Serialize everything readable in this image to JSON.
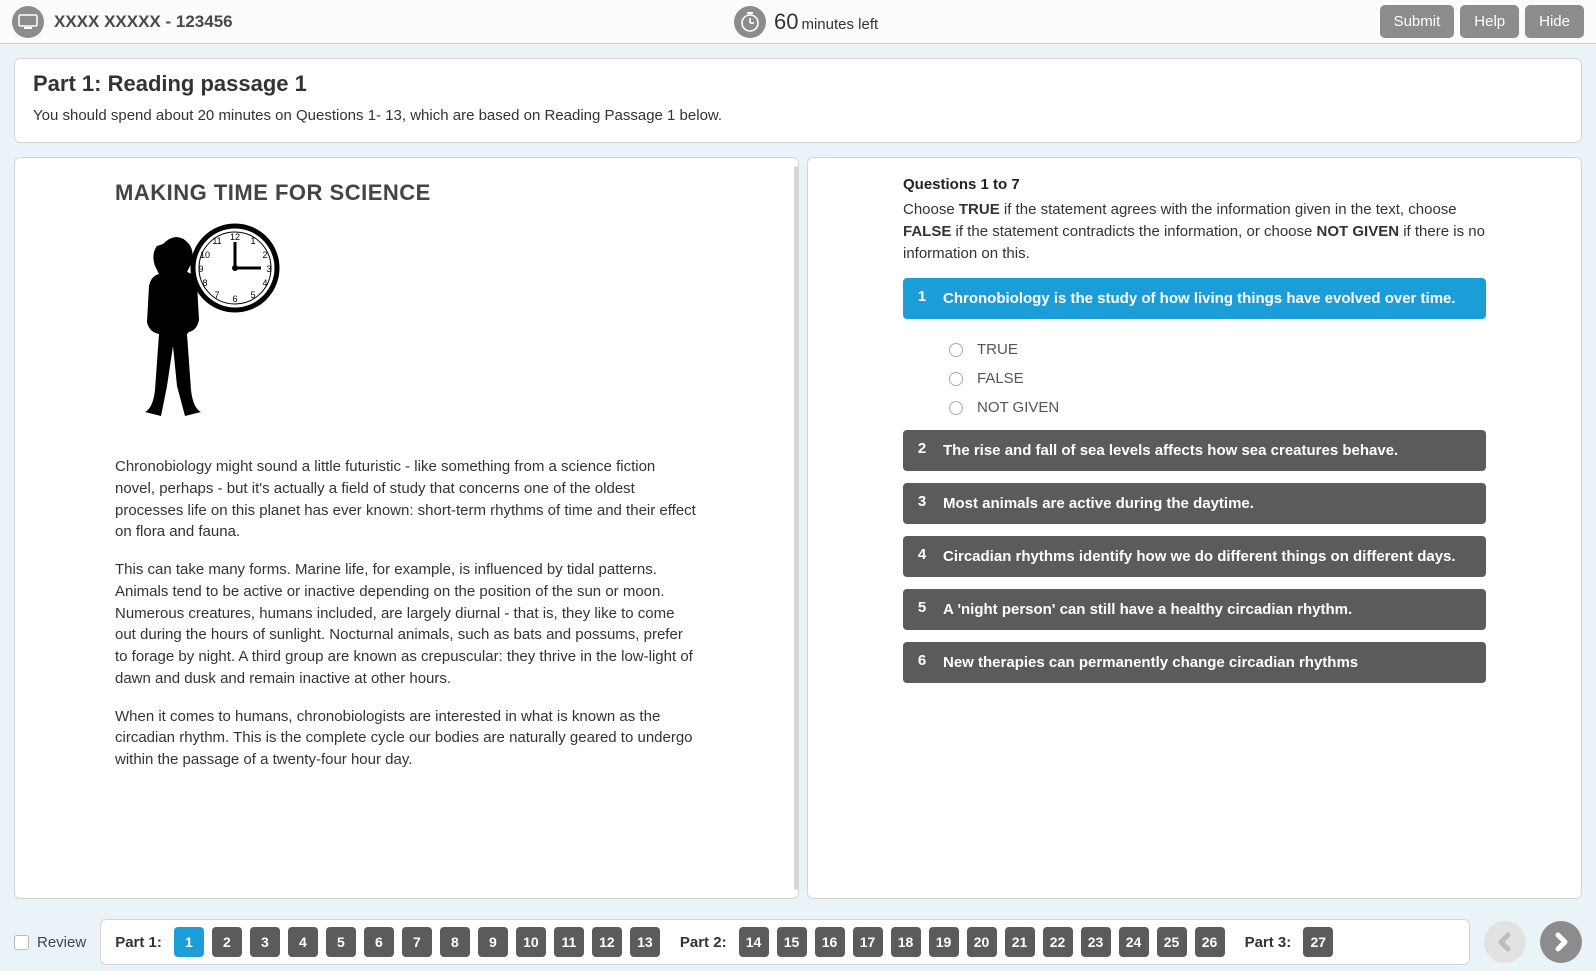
{
  "topbar": {
    "candidate": "XXXX XXXXX - 123456",
    "timer_value": "60",
    "timer_unit": "minutes left",
    "submit": "Submit",
    "help": "Help",
    "hide": "Hide"
  },
  "instructions": {
    "title": "Part 1: Reading passage 1",
    "body": "You should spend about 20 minutes on Questions 1- 13, which are based on Reading Passage 1 below."
  },
  "passage": {
    "title": "MAKING TIME FOR SCIENCE",
    "paragraphs": [
      "Chronobiology might sound a little futuristic - like something from a science fiction novel, perhaps - but it's actually a field of study that concerns one of the oldest processes life on this planet has ever known: short-term rhythms of time and their effect on flora and fauna.",
      "This can take many forms. Marine life, for example, is influenced by tidal patterns. Animals tend to be active or inactive depending on the position of the sun or moon. Numerous creatures, humans included, are largely diurnal - that is, they like to come out during the hours of sunlight. Nocturnal animals, such as bats and possums, prefer to forage by night. A third group are known as crepuscular: they thrive in the low-light of dawn and dusk and remain inactive at other hours.",
      "When it comes to humans, chronobiologists are interested in what is known as the circadian rhythm. This is the complete cycle our bodies are naturally geared to undergo within the passage of a twenty-four hour day."
    ]
  },
  "questions": {
    "heading": "Questions 1 to 7",
    "instr_pre": "Choose ",
    "instr_true": "TRUE",
    "instr_mid1": " if the statement agrees with the information given in the text, choose ",
    "instr_false": "FALSE",
    "instr_mid2": " if the statement contradicts the information, or choose ",
    "instr_ng": "NOT GIVEN",
    "instr_post": " if there is no information on this.",
    "options": [
      "TRUE",
      "FALSE",
      "NOT GIVEN"
    ],
    "items": [
      {
        "num": "1",
        "text": "Chronobiology is the study of how living things have evolved over time.",
        "active": true
      },
      {
        "num": "2",
        "text": "The rise and fall of sea levels affects how sea creatures behave.",
        "active": false
      },
      {
        "num": "3",
        "text": "Most animals are active during the daytime.",
        "active": false
      },
      {
        "num": "4",
        "text": "Circadian rhythms identify how we do different things on different days.",
        "active": false
      },
      {
        "num": "5",
        "text": "A 'night person' can still have a healthy circadian rhythm.",
        "active": false
      },
      {
        "num": "6",
        "text": "New therapies can permanently change circadian rhythms",
        "active": false
      }
    ]
  },
  "bottom": {
    "review": "Review",
    "parts": [
      {
        "label": "Part 1:",
        "nums": [
          "1",
          "2",
          "3",
          "4",
          "5",
          "6",
          "7",
          "8",
          "9",
          "10",
          "11",
          "12",
          "13"
        ],
        "current": "1"
      },
      {
        "label": "Part 2:",
        "nums": [
          "14",
          "15",
          "16",
          "17",
          "18",
          "19",
          "20",
          "21",
          "22",
          "23",
          "24",
          "25",
          "26"
        ],
        "current": ""
      },
      {
        "label": "Part 3:",
        "nums": [
          "27"
        ],
        "current": ""
      }
    ]
  }
}
